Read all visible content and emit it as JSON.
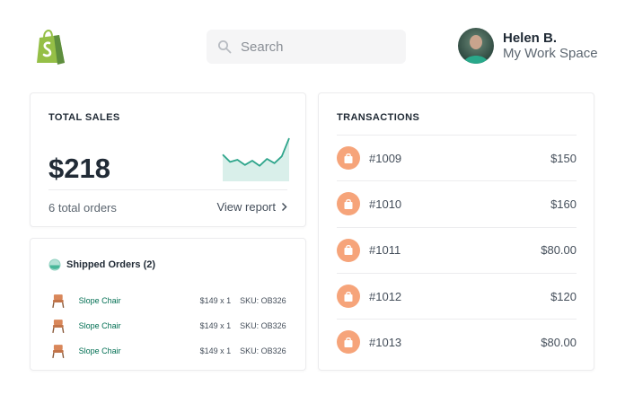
{
  "brand": {
    "logo_icon": "shopify-bag-icon",
    "logo_color": "#95bf47"
  },
  "search": {
    "placeholder": "Search",
    "value": ""
  },
  "user": {
    "name": "Helen B.",
    "workspace": "My Work Space"
  },
  "sales": {
    "title": "TOTAL SALES",
    "amount": "$218",
    "orders": "6 total orders",
    "view_report_label": "View report",
    "sparkline_values": [
      0.62,
      0.45,
      0.5,
      0.38,
      0.48,
      0.36,
      0.52,
      0.42,
      0.58,
      1.0
    ],
    "accent_color": "#2ea58b"
  },
  "shipped": {
    "title": "Shipped Orders (2)",
    "items": [
      {
        "product": "Slope Chair",
        "price": "$149 x 1",
        "sku": "SKU: OB326"
      },
      {
        "product": "Slope Chair",
        "price": "$149 x 1",
        "sku": "SKU: OB326"
      },
      {
        "product": "Slope Chair",
        "price": "$149 x 1",
        "sku": "SKU: OB326"
      }
    ]
  },
  "transactions": {
    "title": "TRANSACTIONS",
    "icon_color": "#f6a47a",
    "items": [
      {
        "id": "#1009",
        "amount": "$150"
      },
      {
        "id": "#1010",
        "amount": "$160"
      },
      {
        "id": "#1011",
        "amount": "$80.00"
      },
      {
        "id": "#1012",
        "amount": "$120"
      },
      {
        "id": "#1013",
        "amount": "$80.00"
      }
    ]
  }
}
